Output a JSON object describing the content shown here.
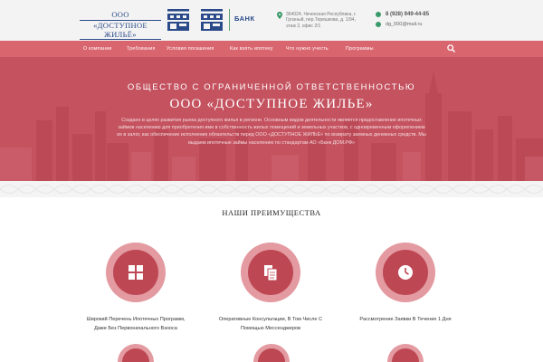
{
  "header": {
    "brand_line1": "ООО",
    "brand_line2": "«ДОСТУПНОЕ ЖИЛЬЁ»",
    "bank_label": "БАНК",
    "address": "364024, Чеченская Республика, г. Грозный, пер.Терешкова, д. 1/94, этаж 2, офис 2/1",
    "phone": "8 (928) 949-44-85",
    "email": "dg_000@mail.ru"
  },
  "nav": {
    "items": [
      "О компании",
      "Требования",
      "Условия погашения",
      "Как взять ипотеку",
      "Что нужно учесть",
      "Программы"
    ]
  },
  "hero": {
    "subtitle": "ОБЩЕСТВО С ОГРАНИЧЕННОЙ ОТВЕТСТВЕННОСТЬЮ",
    "title": "ООО «ДОСТУПНОЕ ЖИЛЬЕ»",
    "text": "Создано в целях развития рынка доступного жилья в регионе. Основным видом деятельности является предоставление ипотечных займов населению для приобретения ими в собственность жилых помещений и земельных участков, с одновременным оформлением их в залог, как обеспечение исполнения обязательств перед ООО «ДОСТУПНОЕ ЖИЛЬЕ» по возврату заемных денежных средств. Мы выдаем ипотечные займы населению по стандартам АО «Банк ДОМ.РФ»"
  },
  "advantages": {
    "title": "НАШИ ПРЕИМУЩЕСТВА",
    "items": [
      {
        "icon": "grid-icon",
        "line1": "Широкий Перечень Ипотечных Программ,",
        "line2": "Даже Без Первоначального Взноса"
      },
      {
        "icon": "documents-icon",
        "line1": "Оперативные Консультации, В Том Числе С",
        "line2": "Помощью Мессенджеров"
      },
      {
        "icon": "clock-icon",
        "line1": "Рассмотрение Заявки В Течение 1 Дня",
        "line2": ""
      }
    ]
  },
  "colors": {
    "accent": "#d9666f",
    "hero": "#c75663",
    "circle_outer": "#e39aa0",
    "circle_inner": "#bd4854",
    "brand_blue": "#2a4a8a"
  }
}
